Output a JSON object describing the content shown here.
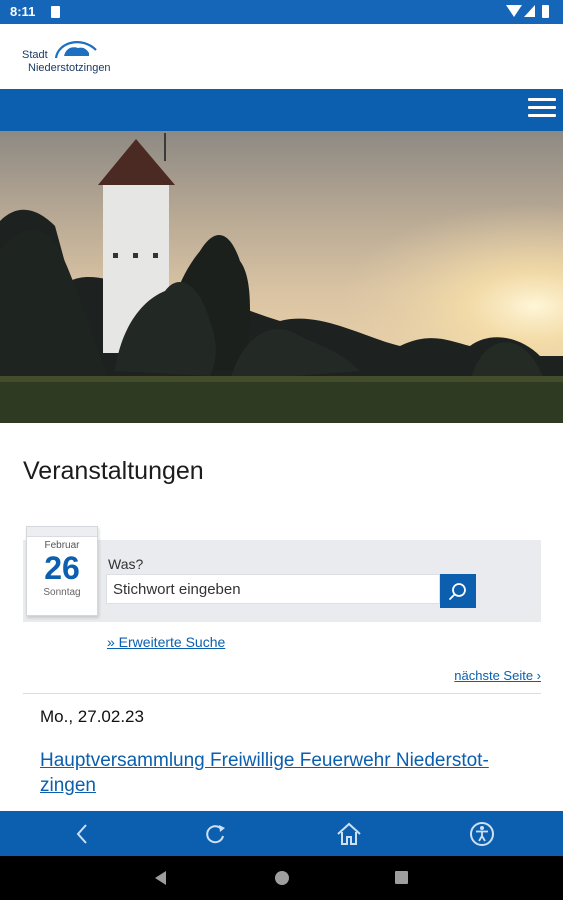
{
  "status_bar": {
    "time": "8:11"
  },
  "logo": {
    "line1": "Stadt",
    "line2": "Niederstotzingen"
  },
  "page": {
    "title": "Veranstaltungen"
  },
  "calendar": {
    "month": "Februar",
    "day": "26",
    "weekday": "Sonntag"
  },
  "search": {
    "label": "Was?",
    "placeholder": "Stichwort eingeben",
    "advanced_link": "» Erweiterte Suche",
    "next_page": "nächste Seite ›"
  },
  "events": [
    {
      "date": "Mo., 27.02.23",
      "title": "Hauptversammlung Freiwillige Feuerwehr Niederstot-zingen"
    }
  ],
  "icons": {
    "menu": "hamburger-menu-icon",
    "search": "magnifier-icon",
    "bottom_nav": [
      "back-icon",
      "reload-icon",
      "home-icon",
      "accessibility-icon"
    ]
  },
  "colors": {
    "primary": "#0b5fae",
    "panel": "#e9ebee"
  }
}
